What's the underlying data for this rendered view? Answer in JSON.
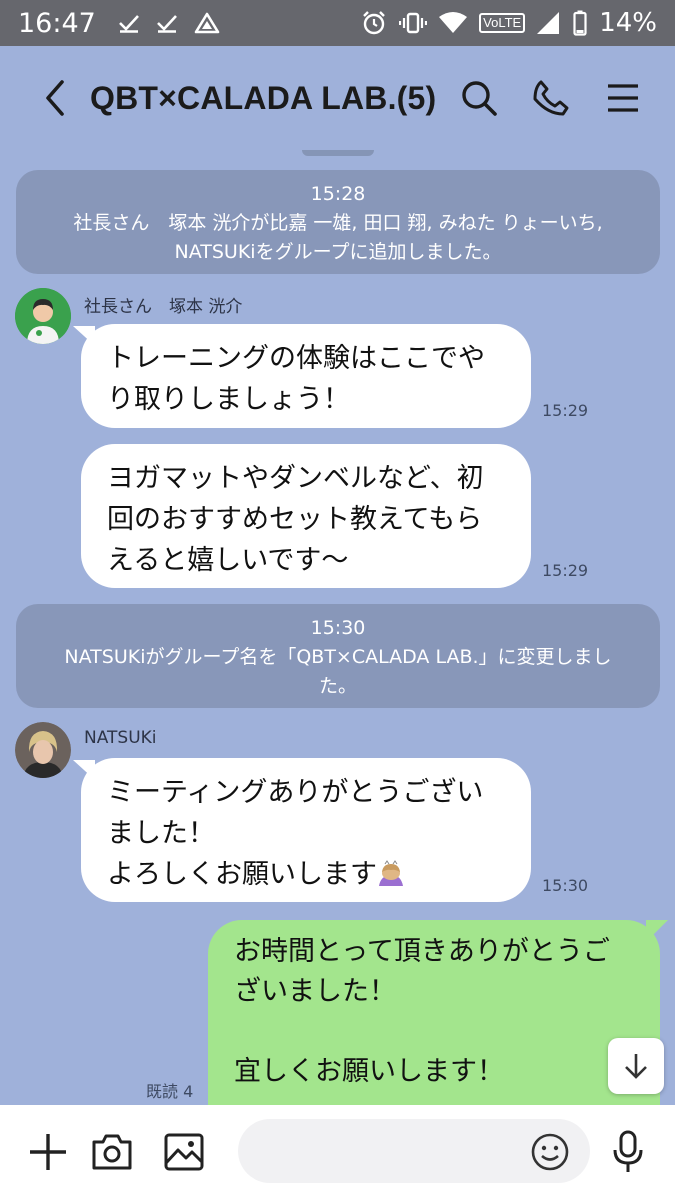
{
  "statusbar": {
    "time": "16:47",
    "volte": "VoLTE",
    "battery": "14%"
  },
  "header": {
    "title": "QBT×CALADA LAB.(5)"
  },
  "messages": {
    "sys1": {
      "time": "15:28",
      "text": "社長さん　塚本 洸介が比嘉 一雄, 田口 翔, みねた りょーいち, NATSUKiをグループに追加しました。"
    },
    "shachou": {
      "name": "社長さん　塚本 洸介",
      "msg1": "トレーニングの体験はここでやり取りしましょう！",
      "msg1_time": "15:29",
      "msg2": "ヨガマットやダンベルなど、初回のおすすめセット教えてもらえると嬉しいです〜",
      "msg2_time": "15:29"
    },
    "sys2": {
      "time": "15:30",
      "text": "NATSUKiがグループ名を「QBT×CALADA LAB.」に変更しました。"
    },
    "natsuki": {
      "name": "NATSUKi",
      "line1": "ミーティングありがとうござい",
      "line2": "ました！",
      "line3": "よろしくお願いします",
      "time": "15:30"
    },
    "mine": {
      "line1": "お時間とって頂きありがとうご",
      "line2": "ざいました！",
      "line3": "",
      "line4": "宜しくお願いします！",
      "read_label": "既読 4"
    }
  },
  "input": {
    "placeholder": ""
  },
  "icons": {
    "back": "chevron-left-icon",
    "search": "search-icon",
    "call": "phone-icon",
    "menu": "menu-icon",
    "plus": "plus-icon",
    "camera": "camera-icon",
    "image": "image-icon",
    "emoji": "emoji-icon",
    "mic": "microphone-icon",
    "scroll": "arrow-down-icon"
  },
  "colors": {
    "background": "#9fb1da",
    "my_bubble": "#a3e58d",
    "system_message": "#8897b9",
    "status_bar": "#66676d"
  }
}
